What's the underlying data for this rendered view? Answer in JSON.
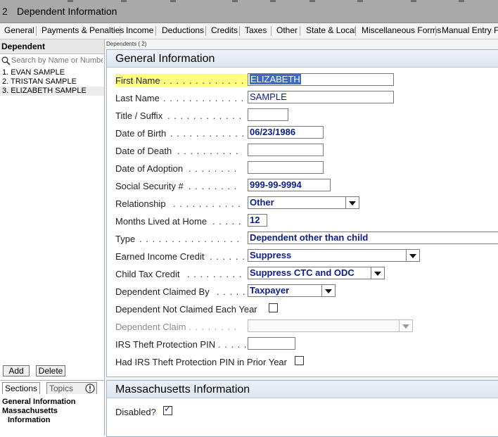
{
  "window": {
    "number": "2",
    "title": "Dependent Information"
  },
  "tabs": [
    "General",
    "Payments & Penalties",
    "Income",
    "Deductions",
    "Credits",
    "Taxes",
    "Other",
    "State & Local",
    "Miscellaneous Forms",
    "Manual Entry For"
  ],
  "left_panel": {
    "header": "Dependent",
    "search_placeholder": "Search by Name or Number",
    "dependents": [
      "1. EVAN SAMPLE",
      "2. TRISTAN SAMPLE",
      "3. ELIZABETH SAMPLE"
    ],
    "add_label": "Add",
    "delete_label": "Delete",
    "tabs": {
      "sections": "Sections",
      "topics": "Topics"
    },
    "sections": [
      "General Information",
      "Massachusetts",
      "Information"
    ]
  },
  "main": {
    "breadcrumb": "Dependents ( 2)",
    "general": {
      "title": "General Information",
      "first_name_label": "First Name",
      "first_name": "ELIZABETH",
      "last_name_label": "Last Name",
      "last_name": "SAMPLE",
      "title_suffix_label": "Title / Suffix",
      "title_suffix": "",
      "dob_label": "Date of Birth",
      "dob": "06/23/1986",
      "dod_label": "Date of Death",
      "dod": "",
      "doa_label": "Date of Adoption",
      "doa": "",
      "ssn_label": "Social Security #",
      "ssn": "999-99-9994",
      "relationship_label": "Relationship",
      "relationship": "Other",
      "months_label": "Months Lived at Home",
      "months": "12",
      "type_label": "Type",
      "type": "Dependent other than child",
      "eic_label": "Earned Income Credit",
      "eic": "Suppress",
      "ctc_label": "Child Tax Credit",
      "ctc": "Suppress CTC and ODC",
      "claimed_by_label": "Dependent Claimed By",
      "claimed_by": "Taxpayer",
      "not_claimed_label": "Dependent Not Claimed Each Year",
      "not_claimed_checked": false,
      "dep_claim_label": "Dependent Claim",
      "dep_claim": "",
      "irs_pin_label": "IRS Theft Protection PIN",
      "irs_pin": "",
      "had_pin_label": "Had IRS Theft Protection PIN in Prior Year",
      "had_pin_checked": false
    },
    "massachusetts": {
      "title": "Massachusetts Information",
      "disabled_label": "Disabled?",
      "disabled_checked": true
    }
  }
}
